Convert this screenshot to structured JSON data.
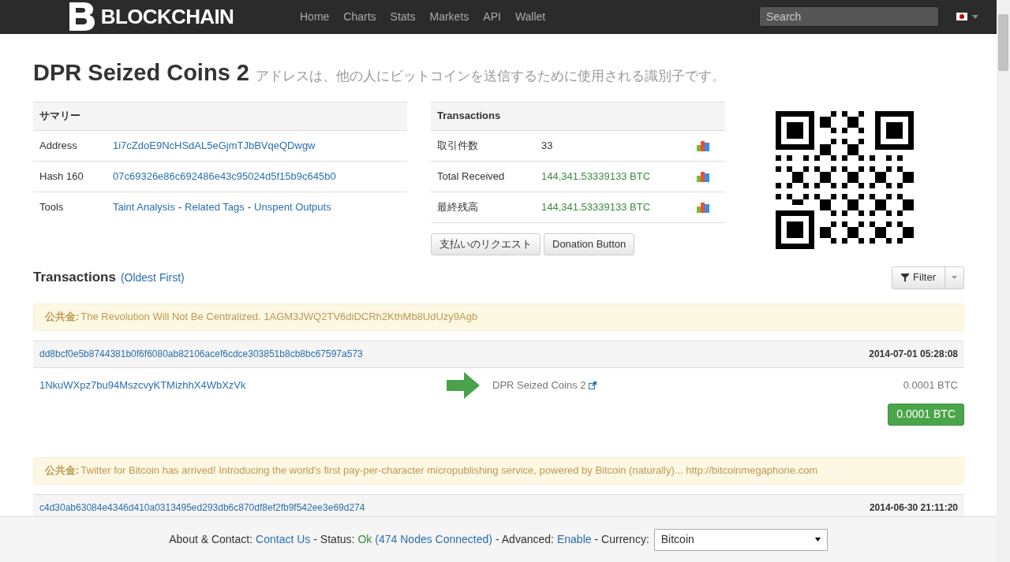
{
  "nav": {
    "logo": "BLOCKCHAIN",
    "links": [
      "Home",
      "Charts",
      "Stats",
      "Markets",
      "API",
      "Wallet"
    ],
    "search": {
      "placeholder": "Search"
    }
  },
  "heading": {
    "title": "DPR Seized Coins 2",
    "subtitle": "アドレスは、他の人にビットコインを送信するために使用される識別子です。"
  },
  "summary": {
    "header": "サマリー",
    "rows": [
      {
        "label": "Address",
        "links": [
          "1i7cZdoE9NcHSdAL5eGjmTJbBVqeQDwgw"
        ]
      },
      {
        "label": "Hash 160",
        "links": [
          "07c69326e86c692486e43c95024d5f15b9c645b0"
        ]
      },
      {
        "label": "Tools",
        "links": [
          "Taint Analysis",
          "Related Tags",
          "Unspent Outputs"
        ],
        "separator": "-"
      }
    ]
  },
  "totals": {
    "header": "Transactions",
    "rows": [
      {
        "label": "取引件数",
        "value": "33",
        "kind": "count"
      },
      {
        "label": "Total Received",
        "value": "144,341.53339133 BTC",
        "kind": "amount"
      },
      {
        "label": "最終残高",
        "value": "144,341.53339133 BTC",
        "kind": "amount"
      }
    ],
    "buttons": [
      "支払いのリクエスト",
      "Donation Button"
    ]
  },
  "section": {
    "title": "Transactions",
    "order_link": "(Oldest First)",
    "filter": "Filter"
  },
  "transactions": [
    {
      "note_label": "公共金:",
      "note": "The Revolution Will Not Be Centralized. 1AGM3JWQ2TV6diDCRh2KthMb8UdUzy9Agb",
      "hash": "dd8bcf0e5b8744381b0f6f6080ab82106acef6cdce303851b8cb8bc67597a573",
      "time": "2014-07-01 05:28:08",
      "input": "1NkuWXpz7bu94MszcvyKTMizhhX4WbXzVk",
      "output": "DPR Seized Coins 2",
      "amount": "0.0001 BTC",
      "total": "0.0001 BTC"
    },
    {
      "note_label": "公共金:",
      "note": "Twitter for Bitcoin has arrived! Introducing the world's first pay-per-character micropublishing service, powered by Bitcoin (naturally)... http://bitcoinmegaphone.com",
      "hash": "c4d30ab63084e4346d410a0313495ed293db6c870df8ef2fb9f542ee3e69d274",
      "time": "2014-06-30 21:11:20"
    }
  ],
  "footer": {
    "parts": [
      {
        "kind": "text",
        "text": "About & Contact:"
      },
      {
        "kind": "link",
        "text": "Contact Us"
      },
      {
        "kind": "text",
        "text": "- Status:"
      },
      {
        "kind": "ok",
        "text": "Ok"
      },
      {
        "kind": "link",
        "text": "(474 Nodes Connected)"
      },
      {
        "kind": "text",
        "text": "- Advanced:"
      },
      {
        "kind": "link",
        "text": "Enable"
      },
      {
        "kind": "text",
        "text": "- Currency:"
      }
    ],
    "currency": "Bitcoin"
  }
}
